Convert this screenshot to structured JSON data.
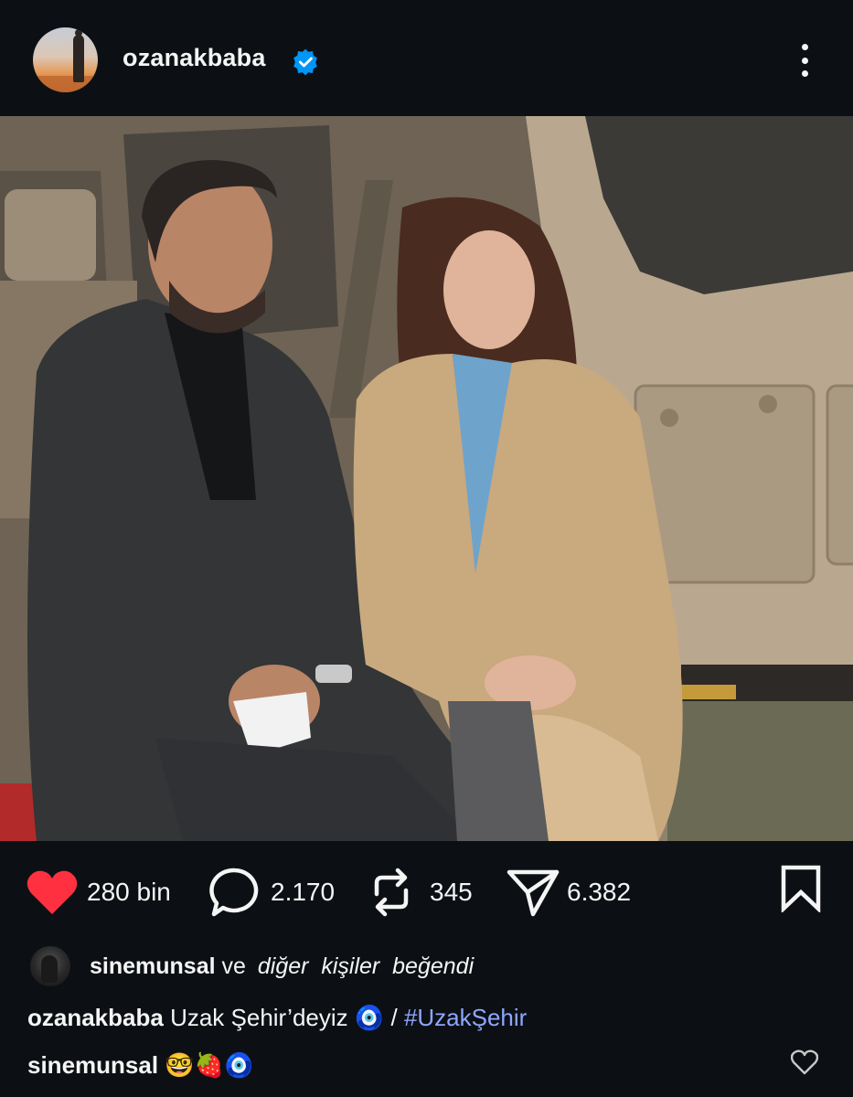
{
  "post": {
    "author": "ozanakbaba",
    "verified_icon": "verified-badge-icon",
    "menu_icon": "more-vertical-icon"
  },
  "actions": {
    "likes": "280 bin",
    "comments": "2.170",
    "reposts": "345",
    "shares": "6.382"
  },
  "liked_by": {
    "user": "sinemunsal",
    "connector": "ve",
    "rest": "diğer  kişiler  beğendi"
  },
  "caption": {
    "user": "ozanakbaba",
    "text": "Uzak Şehir’deyiz 🧿 / ",
    "hashtag": "#UzakŞehir"
  },
  "comment": {
    "user": "sinemunsal",
    "text": "🤓🍓🧿"
  },
  "colors": {
    "background": "#0c1014",
    "like_red": "#ff3040",
    "verified_blue": "#0095f6",
    "hashtag": "#8fa6ff"
  }
}
